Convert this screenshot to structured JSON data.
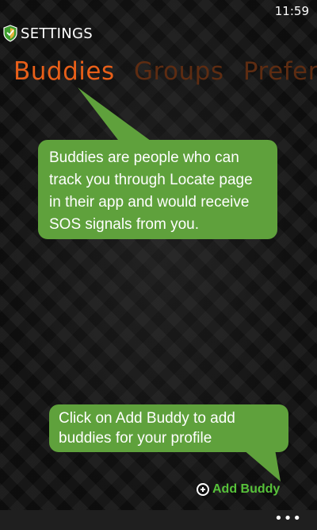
{
  "status_bar": {
    "time": "11:59"
  },
  "header": {
    "title": "SETTINGS",
    "icon": "shield-logo-icon"
  },
  "pivot": {
    "tabs": [
      {
        "label": "Buddies",
        "active": true
      },
      {
        "label": "Groups",
        "active": false
      },
      {
        "label": "Preferences",
        "active": false
      }
    ]
  },
  "tips": {
    "buddies_tip": "Buddies are people who can track you through Locate page in their app and would receive SOS signals from you.",
    "add_buddy_tip": "Click on Add Buddy to add buddies for your profile"
  },
  "actions": {
    "add_buddy_label": "Add Buddy",
    "add_icon": "plus-circle-icon"
  },
  "app_bar": {
    "more_label": "•••"
  },
  "colors": {
    "accent": "#e85f19",
    "inactive_tab": "#5d2c12",
    "callout": "#5fa13c",
    "add_buddy": "#57c23a"
  }
}
